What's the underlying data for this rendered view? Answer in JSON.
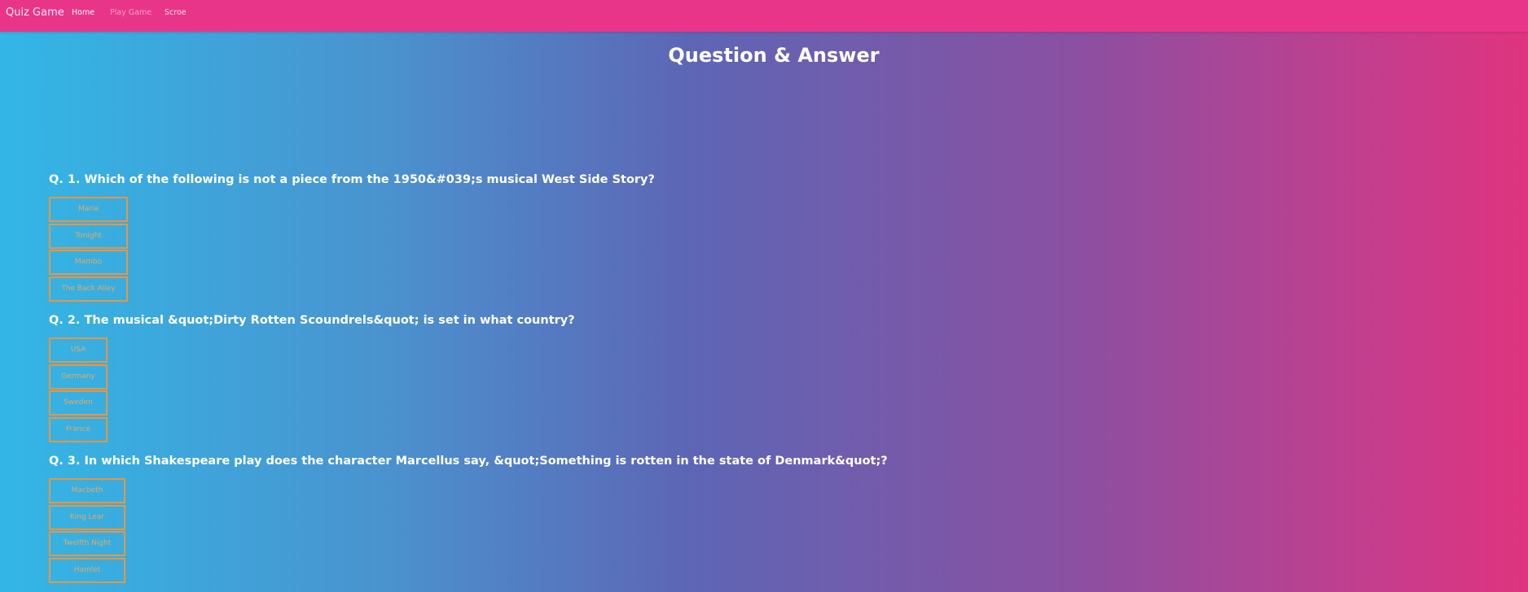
{
  "nav": {
    "brand": "Quiz Game",
    "links": [
      "Home",
      "Play Game",
      "Scroe"
    ]
  },
  "page": {
    "title": "Question & Answer"
  },
  "questions": [
    {
      "text": "Q. 1. Which of the following is not a piece from the 1950&#039;s musical West Side Story?",
      "options": [
        "Maria",
        "Tonight",
        "Mambo",
        "The Back Alley"
      ]
    },
    {
      "text": "Q. 2. The musical &quot;Dirty Rotten Scoundrels&quot; is set in what country?",
      "options": [
        "USA",
        "Germany",
        "Sweden",
        "France"
      ]
    },
    {
      "text": "Q. 3. In which Shakespeare play does the character Marcellus say, &quot;Something is rotten in the state of Denmark&quot;?",
      "options": [
        "Macbeth",
        "King Lear",
        "Twelfth Night",
        "Hamlet"
      ]
    }
  ],
  "colors": {
    "navbar": "#e8358a",
    "option_border": "#e99542",
    "gradient_start": "#32b7e6",
    "gradient_end": "#df347f"
  }
}
